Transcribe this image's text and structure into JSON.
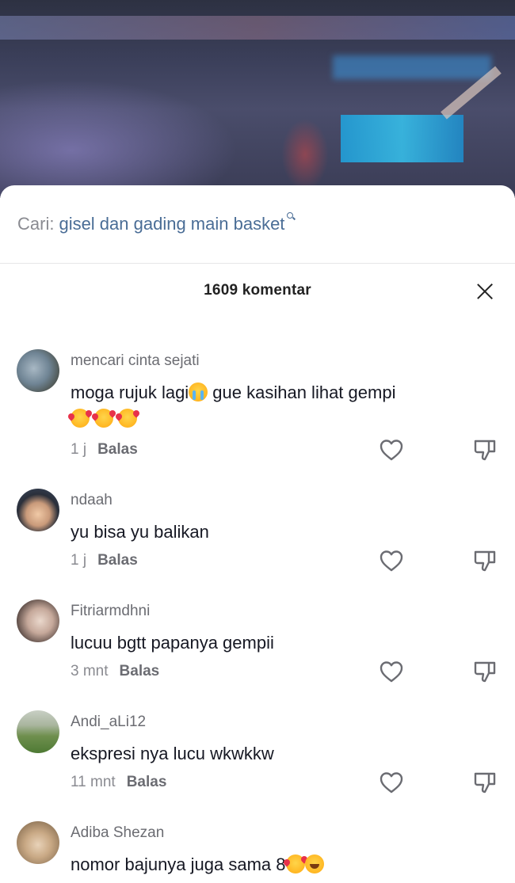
{
  "search": {
    "prefix": "Cari:",
    "query": "gisel dan gading main basket"
  },
  "comments_header": {
    "count_label": "1609 komentar"
  },
  "comments": [
    {
      "username": "mencari cinta sejati",
      "text_a": "moga rujuk lagi",
      "text_b": " gue kasihan lihat gempi",
      "time": "1 j",
      "reply_label": "Balas"
    },
    {
      "username": "ndaah",
      "text": "yu bisa yu balikan",
      "time": "1 j",
      "reply_label": "Balas"
    },
    {
      "username": "Fitriarmdhni",
      "text": "lucuu bgtt papanya gempii",
      "time": "3 mnt",
      "reply_label": "Balas"
    },
    {
      "username": "Andi_aLi12",
      "text": "ekspresi nya lucu wkwkkw",
      "time": "11 mnt",
      "reply_label": "Balas"
    },
    {
      "username": "Adiba Shezan",
      "text": "nomor bajunya juga sama 8"
    }
  ],
  "icons": {
    "like": "heart-outline-icon",
    "dislike": "thumbs-down-icon",
    "close": "close-icon",
    "search": "search-icon"
  },
  "colors": {
    "search_term": "#4a6d96",
    "text": "#161823",
    "muted": "#8a8b91"
  }
}
